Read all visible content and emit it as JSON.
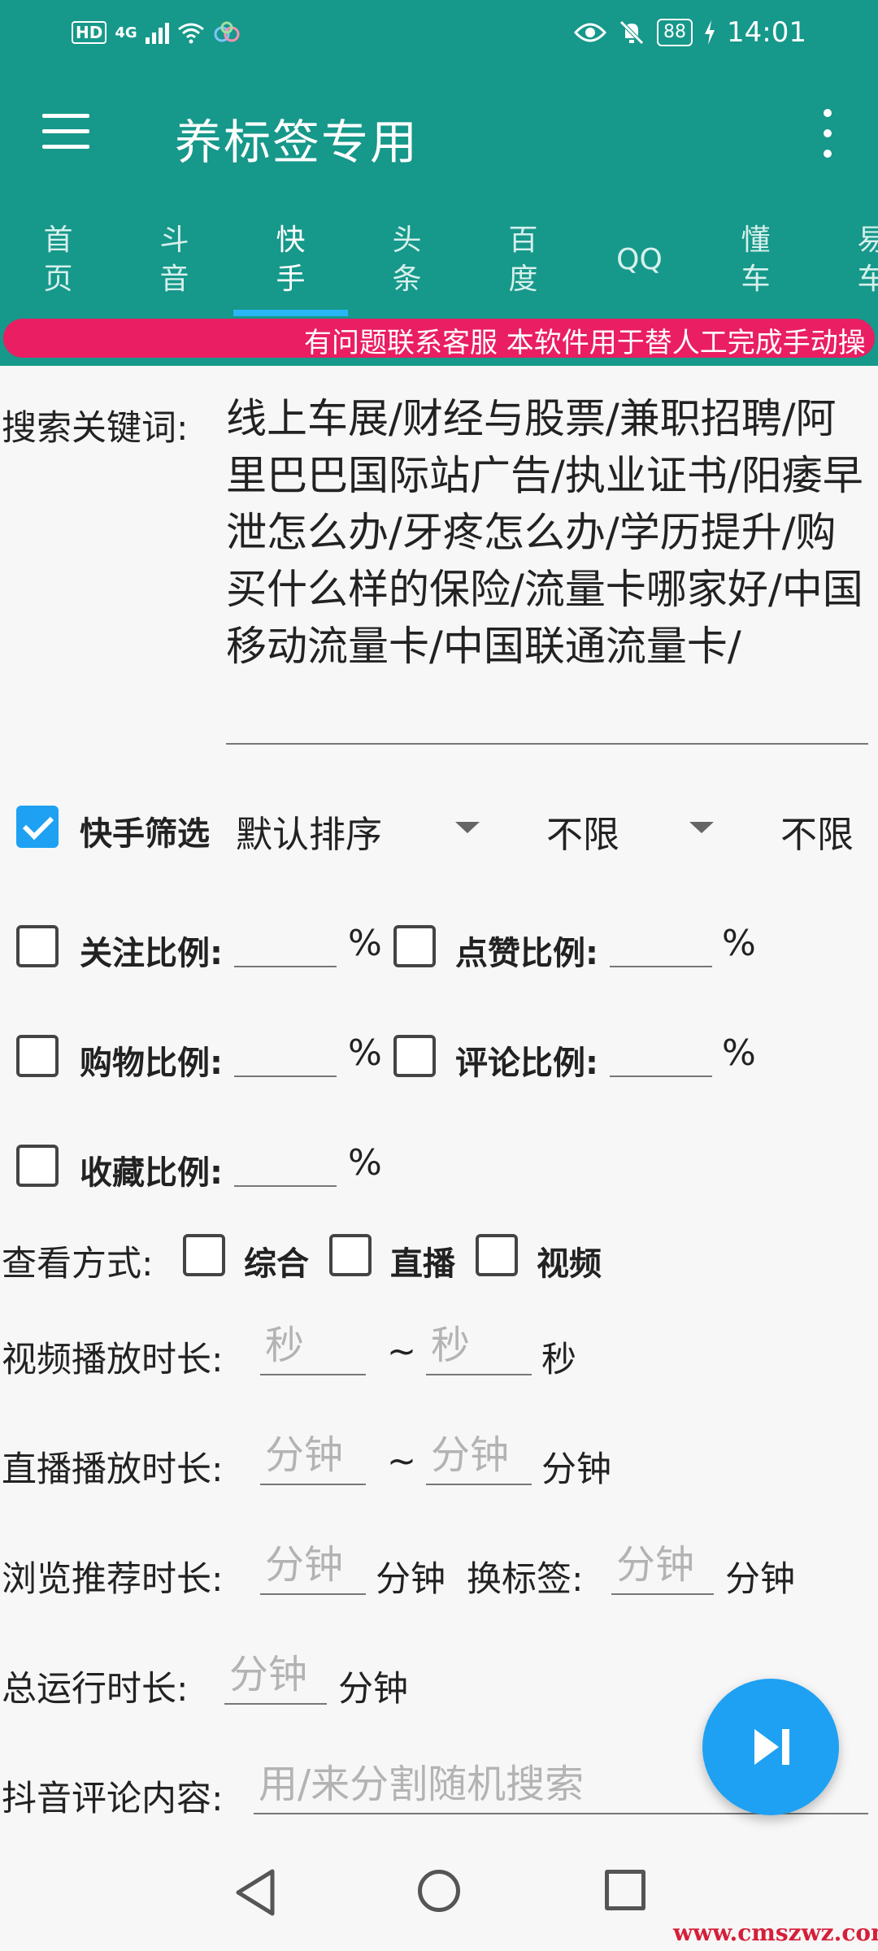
{
  "status_bar": {
    "hd": "HD",
    "network": "4G",
    "battery": "88",
    "time": "14:01"
  },
  "app": {
    "title": "养标签专用"
  },
  "tabs": [
    {
      "label": "首\n页"
    },
    {
      "label": "斗\n音"
    },
    {
      "label": "快\n手",
      "active": true
    },
    {
      "label": "头\n条"
    },
    {
      "label": "百\n度"
    },
    {
      "label": "QQ"
    },
    {
      "label": "懂\n车"
    },
    {
      "label": "易\n车"
    }
  ],
  "marquee": "有问题联系客服 本软件用于替人工完成手动操",
  "form": {
    "keyword_label": "搜索关键词:",
    "keyword_value": "线上车展/财经与股票/兼职招聘/阿里巴巴国际站广告/执业证书/阳痿早泄怎么办/牙疼怎么办/学历提升/购买什么样的保险/流量卡哪家好/中国移动流量卡/中国联通流量卡/",
    "filter": {
      "label": "快手筛选",
      "checked": true,
      "sort_value": "默认排序",
      "limit1_value": "不限",
      "limit2_value": "不限"
    },
    "ratios": {
      "follow_label": "关注比例:",
      "like_label": "点赞比例:",
      "shop_label": "购物比例:",
      "comment_label": "评论比例:",
      "favorite_label": "收藏比例:",
      "unit": "%"
    },
    "view_mode": {
      "label": "查看方式:",
      "options": [
        "综合",
        "直播",
        "视频"
      ]
    },
    "video_duration": {
      "label": "视频播放时长:",
      "placeholder": "秒",
      "separator": "~",
      "unit": "秒"
    },
    "live_duration": {
      "label": "直播播放时长:",
      "placeholder": "分钟",
      "separator": "~",
      "unit": "分钟"
    },
    "browse": {
      "label": "浏览推荐时长:",
      "placeholder": "分钟",
      "unit": "分钟",
      "switch_label": "换标签:",
      "switch_placeholder": "分钟",
      "switch_unit": "分钟"
    },
    "total": {
      "label": "总运行时长:",
      "placeholder": "分钟",
      "unit": "分钟"
    },
    "comment": {
      "label": "抖音评论内容:",
      "placeholder": "用/来分割随机搜索"
    }
  },
  "fab": {
    "icon": "skip-next-icon"
  },
  "watermark": "www.cmszwz.com",
  "colors": {
    "primary": "#16988a",
    "accent": "#1ea1f2",
    "marquee": "#e91e63"
  }
}
